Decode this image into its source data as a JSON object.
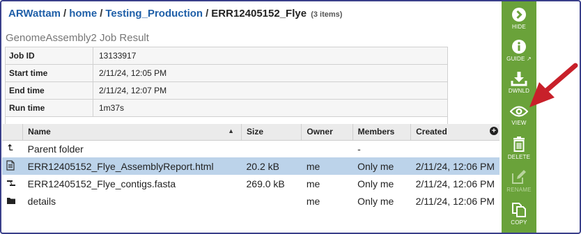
{
  "breadcrumb": {
    "user": "ARWattam",
    "home": "home",
    "folder": "Testing_Production",
    "current": "ERR12405152_Flye",
    "count": "(3 items)",
    "separator": "/"
  },
  "job": {
    "title": "GenomeAssembly2 Job Result",
    "rows": [
      {
        "label": "Job ID",
        "value": "13133917"
      },
      {
        "label": "Start time",
        "value": "2/11/24, 12:05 PM"
      },
      {
        "label": "End time",
        "value": "2/11/24, 12:07 PM"
      },
      {
        "label": "Run time",
        "value": "1m37s"
      }
    ]
  },
  "files": {
    "columns": {
      "name": "Name",
      "size": "Size",
      "owner": "Owner",
      "members": "Members",
      "created": "Created"
    },
    "sort_icon": "caret-up-icon",
    "add_icon": "plus-circle-icon",
    "rows": [
      {
        "icon": "parent-folder-icon",
        "name": "Parent folder",
        "size": "",
        "owner": "",
        "members": "-",
        "created": "",
        "selected": false
      },
      {
        "icon": "document-icon",
        "name": "ERR12405152_Flye_AssemblyReport.html",
        "size": "20.2 kB",
        "owner": "me",
        "members": "Only me",
        "created": "2/11/24, 12:06 PM",
        "selected": true
      },
      {
        "icon": "contigs-icon",
        "name": "ERR12405152_Flye_contigs.fasta",
        "size": "269.0 kB",
        "owner": "me",
        "members": "Only me",
        "created": "2/11/24, 12:06 PM",
        "selected": false
      },
      {
        "icon": "folder-icon",
        "name": "details",
        "size": "",
        "owner": "me",
        "members": "Only me",
        "created": "2/11/24, 12:06 PM",
        "selected": false
      }
    ]
  },
  "sidebar": {
    "hide": "HIDE",
    "guide": "GUIDE",
    "download": "DWNLD",
    "view": "VIEW",
    "delete": "DELETE",
    "rename": "RENAME",
    "copy": "COPY"
  },
  "colors": {
    "sidebar": "#6aa23a",
    "selected_row": "#bcd3ea",
    "link": "#1f5fa8",
    "annotation_arrow": "#c8202a"
  }
}
